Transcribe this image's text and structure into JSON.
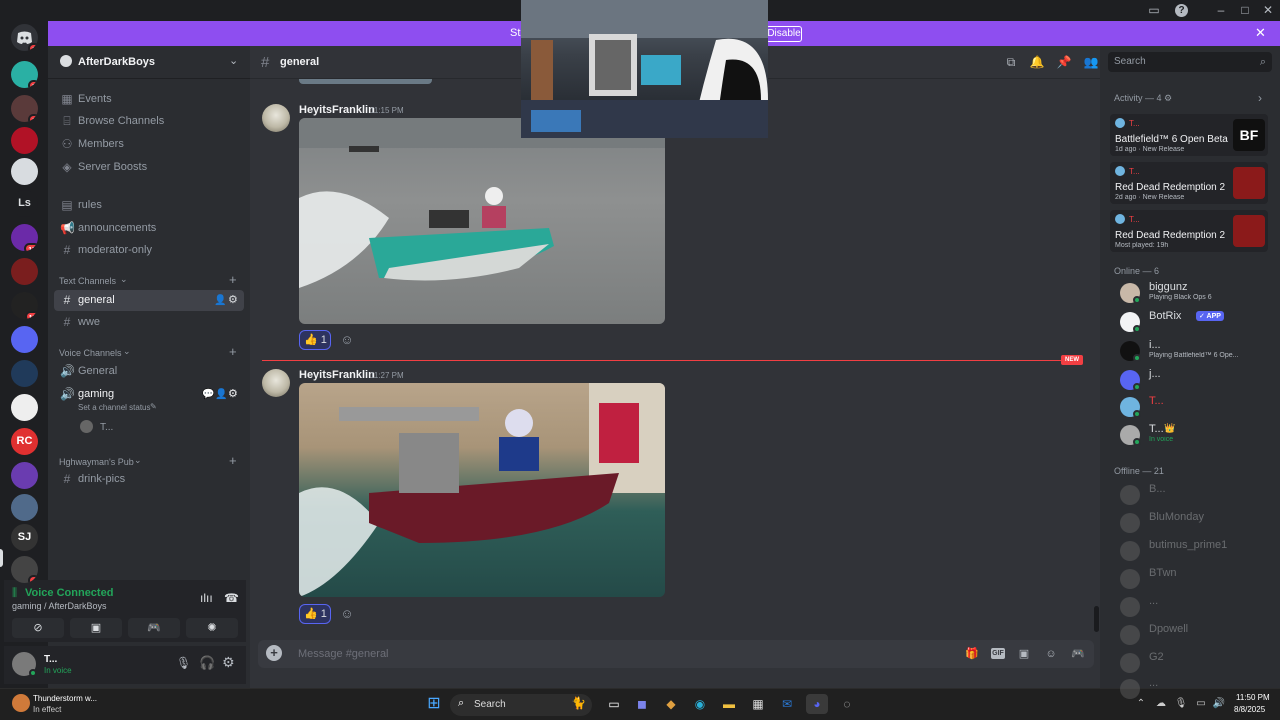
{
  "titlebar": {
    "buttons": [
      "inbox",
      "help",
      "minimize",
      "maximize",
      "close"
    ]
  },
  "banner": {
    "text": "Str",
    "disable_label": "Disable"
  },
  "rail": {
    "home_badge": "1",
    "servers": [
      {
        "label": "",
        "badge": "3",
        "color": "#2ab0a4"
      },
      {
        "label": "",
        "badge": "1",
        "color": "#5a3a3a"
      },
      {
        "label": "",
        "badge": "",
        "color": "#b11226"
      },
      {
        "label": "",
        "badge": "",
        "color": "#d8dce0"
      },
      {
        "label": "Ls",
        "badge": "",
        "color": "#1e1f22"
      },
      {
        "label": "",
        "badge": "15",
        "color": "#6b2aa8"
      },
      {
        "label": "",
        "badge": "",
        "color": "#7a1e1e"
      },
      {
        "label": "",
        "badge": "11",
        "color": "#222"
      },
      {
        "label": "",
        "badge": "",
        "color": "#5865f2"
      },
      {
        "label": "",
        "badge": "",
        "color": "#203a5a"
      },
      {
        "label": "",
        "badge": "",
        "color": "#eee"
      },
      {
        "label": "RC",
        "badge": "",
        "color": "#e03030"
      },
      {
        "label": "",
        "badge": "",
        "color": "#6a3cb0"
      },
      {
        "label": "",
        "badge": "",
        "color": "#506a8a"
      },
      {
        "label": "SJ",
        "badge": "",
        "color": "#333"
      },
      {
        "label": "",
        "badge": "4",
        "color": "#444"
      }
    ]
  },
  "server": {
    "name": "AfterDarkBoys"
  },
  "channels": {
    "top": [
      {
        "icon": "calendar",
        "label": "Events"
      },
      {
        "icon": "browse",
        "label": "Browse Channels"
      },
      {
        "icon": "members",
        "label": "Members"
      },
      {
        "icon": "boost",
        "label": "Server Boosts"
      }
    ],
    "misc": [
      {
        "icon": "rules",
        "label": "rules"
      },
      {
        "icon": "megaphone",
        "label": "announcements"
      },
      {
        "icon": "hash",
        "label": "moderator-only"
      }
    ],
    "text_category": "Text Channels",
    "text": [
      {
        "label": "general",
        "active": true
      },
      {
        "label": "wwe",
        "active": false
      }
    ],
    "voice_category": "Voice Channels",
    "voice": [
      {
        "label": "General"
      },
      {
        "label": "gaming",
        "status": "Set a channel status",
        "members": [
          "T..."
        ]
      }
    ],
    "pub_category": "Hghwayman's Pub",
    "pub": [
      {
        "label": "drink-pics"
      }
    ]
  },
  "voice_panel": {
    "status": "Voice Connected",
    "location": "gaming / AfterDarkBoys"
  },
  "user_panel": {
    "name": "T...",
    "status": "In voice"
  },
  "chat": {
    "channel": "general",
    "messages": [
      {
        "author": "HeyitsFranklin",
        "time": "11:15 PM",
        "reaction": {
          "emoji": "👍",
          "count": "1"
        }
      },
      {
        "author": "HeyitsFranklin",
        "time": "11:27 PM",
        "reaction": {
          "emoji": "👍",
          "count": "1"
        }
      }
    ],
    "new_label": "NEW",
    "composer_placeholder": "Message #general"
  },
  "right": {
    "search_placeholder": "Search",
    "activity_header": "Activity — 4",
    "activities": [
      {
        "user": "T...",
        "title": "Battlefield™ 6 Open Beta",
        "sub": "1d ago · New Release",
        "img": "BF",
        "img_color": "#101010"
      },
      {
        "user": "T...",
        "title": "Red Dead Redemption 2",
        "sub": "2d ago · New Release",
        "img": "",
        "img_color": "#8b1a1a"
      },
      {
        "user": "T...",
        "title": "Red Dead Redemption 2",
        "sub": "Most played: 19h",
        "img": "",
        "img_color": "#8b1a1a"
      }
    ],
    "online_header": "Online — 6",
    "online": [
      {
        "name": "biggunz",
        "activity": "Playing Black Ops 6",
        "color": "#c8b8a8"
      },
      {
        "name": "BotRix",
        "activity": "",
        "app": "✓ APP",
        "color": "#f2f3f5"
      },
      {
        "name": "i...",
        "activity": "Playing Battlefield™ 6 Ope...",
        "color": "#111"
      },
      {
        "name": "j...",
        "activity": "",
        "color": "#5865f2"
      },
      {
        "name": "T...",
        "activity": "",
        "color": "#6fb4e0",
        "red": true
      },
      {
        "name": "T...",
        "activity": "In voice",
        "color": "#aaa",
        "crown": "👑"
      }
    ],
    "offline_header": "Offline — 21",
    "offline": [
      "B...",
      "BluMonday",
      "butimus_prime1",
      "BTwn",
      "...",
      "Dpowell",
      "G2",
      "..."
    ]
  },
  "taskbar": {
    "weather_title": "Thunderstorm w...",
    "weather_sub": "In effect",
    "search_label": "Search",
    "time": "11:50 PM",
    "date": "8/8/2025"
  }
}
